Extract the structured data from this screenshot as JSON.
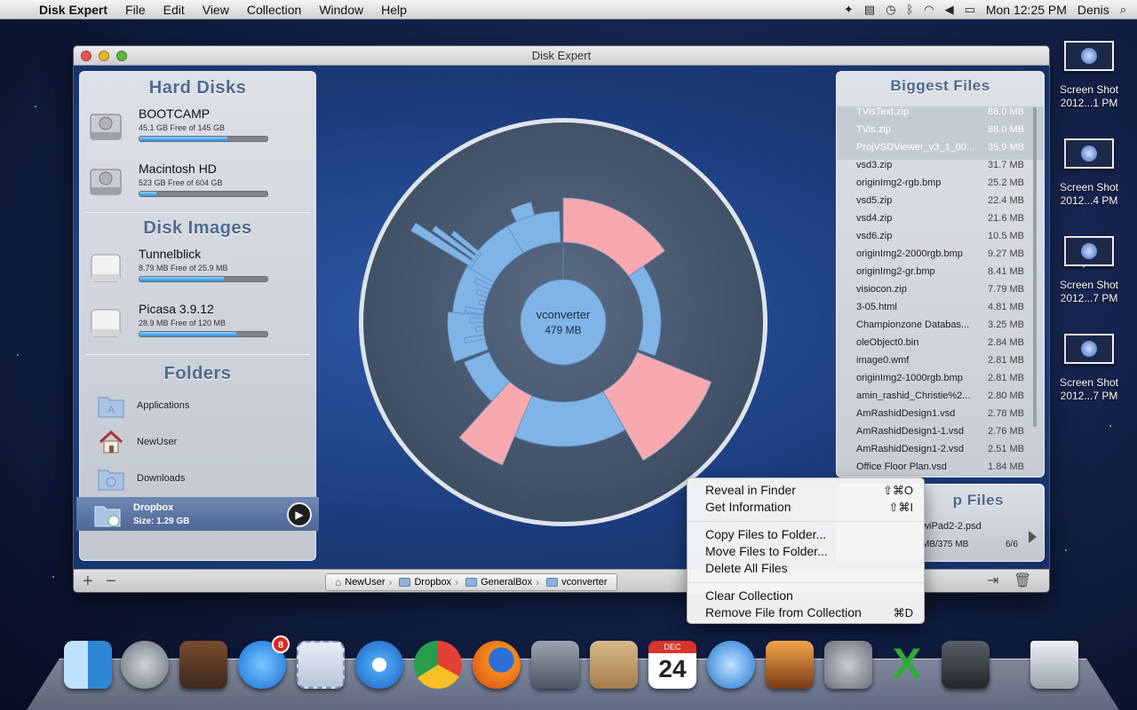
{
  "menubar": {
    "app_name": "Disk Expert",
    "items": [
      "File",
      "Edit",
      "View",
      "Collection",
      "Window",
      "Help"
    ],
    "clock": "Mon 12:25 PM",
    "user": "Denis"
  },
  "window": {
    "title": "Disk Expert"
  },
  "left": {
    "hard_disks_title": "Hard Disks",
    "hard_disks": [
      {
        "name": "BOOTCAMP",
        "sub": "45.1 GB Free of 145 GB",
        "used_fraction": 0.69
      },
      {
        "name": "Macintosh HD",
        "sub": "523 GB Free of 604 GB",
        "used_fraction": 0.13
      }
    ],
    "disk_images_title": "Disk Images",
    "disk_images": [
      {
        "name": "Tunnelblick",
        "sub": "8.79 MB Free of 25.9 MB",
        "used_fraction": 0.66
      },
      {
        "name": "Picasa 3.9.12",
        "sub": "28.9 MB Free of 120 MB",
        "used_fraction": 0.76
      }
    ],
    "folders_title": "Folders",
    "folders": [
      {
        "name": "Applications"
      },
      {
        "name": "NewUser"
      },
      {
        "name": "Downloads"
      },
      {
        "name": "Dropbox",
        "size": "Size: 1.29 GB"
      }
    ]
  },
  "center": {
    "name": "vconverter",
    "size": "479 MB"
  },
  "biggest_files": {
    "title": "Biggest Files",
    "files": [
      {
        "name": "TVisText.zip",
        "size": "88.0 MB",
        "highlight": true
      },
      {
        "name": "TVis.zip",
        "size": "88.0 MB",
        "highlight": true
      },
      {
        "name": "ProjVSDViewer_v3_1_00...",
        "size": "35.9 MB",
        "highlight": true
      },
      {
        "name": "vsd3.zip",
        "size": "31.7 MB"
      },
      {
        "name": "originImg2-rgb.bmp",
        "size": "25.2 MB"
      },
      {
        "name": "vsd5.zip",
        "size": "22.4 MB"
      },
      {
        "name": "vsd4.zip",
        "size": "21.6 MB"
      },
      {
        "name": "vsd6.zip",
        "size": "10.5 MB"
      },
      {
        "name": "originImg2-2000rgb.bmp",
        "size": "9.27 MB"
      },
      {
        "name": "originImg2-gr.bmp",
        "size": "8.41 MB"
      },
      {
        "name": "visiocon.zip",
        "size": "7.79 MB"
      },
      {
        "name": "3-05.html",
        "size": "4.81 MB"
      },
      {
        "name": "Championzone Databas...",
        "size": "3.25 MB"
      },
      {
        "name": "oleObject0.bin",
        "size": "2.84 MB"
      },
      {
        "name": "image0.wmf",
        "size": "2.81 MB"
      },
      {
        "name": "originImg2-1000rgb.bmp",
        "size": "2.81 MB"
      },
      {
        "name": "amin_rashid_Christie%2...",
        "size": "2.80 MB"
      },
      {
        "name": "AmRashidDesign1.vsd",
        "size": "2.78 MB"
      },
      {
        "name": "AmRashidDesign1-1.vsd",
        "size": "2.76 MB"
      },
      {
        "name": "AmRashidDesign1-2.vsd",
        "size": "2.51 MB"
      },
      {
        "name": "Office Floor Plan.vsd",
        "size": "1.84 MB"
      }
    ]
  },
  "dup_files": {
    "title_partial": "p Files",
    "file": "ewiPad2-2.psd",
    "size": "MB/375 MB",
    "count": "6/6"
  },
  "path": [
    "NewUser",
    "Dropbox",
    "GeneralBox",
    "vconverter"
  ],
  "context_menu": {
    "group1": [
      {
        "label": "Reveal in Finder",
        "shortcut": "⇧⌘O"
      },
      {
        "label": "Get Information",
        "shortcut": "⇧⌘I"
      }
    ],
    "group2": [
      {
        "label": "Copy Files to Folder...",
        "shortcut": ""
      },
      {
        "label": "Move Files to Folder...",
        "shortcut": ""
      },
      {
        "label": "Delete All Files",
        "shortcut": ""
      }
    ],
    "group3": [
      {
        "label": "Clear Collection",
        "shortcut": ""
      },
      {
        "label": "Remove File from Collection",
        "shortcut": "⌘D"
      }
    ]
  },
  "desktop": [
    {
      "l1": "Screen Shot",
      "l2": "2012...1 PM"
    },
    {
      "l1": "Screen Shot",
      "l2": "2012...4 PM"
    },
    {
      "l1": "Screen Shot",
      "l2": "2012...7 PM"
    },
    {
      "l1": "Screen Shot",
      "l2": "2012...7 PM"
    }
  ],
  "dock": {
    "app_store_badge": "8",
    "calendar_day": "24",
    "calendar_month": "DEC"
  },
  "colors": {
    "sunburst_blue": "#7fb4e6",
    "sunburst_pink": "#f7a9ae",
    "accent": "#4f6a90"
  }
}
